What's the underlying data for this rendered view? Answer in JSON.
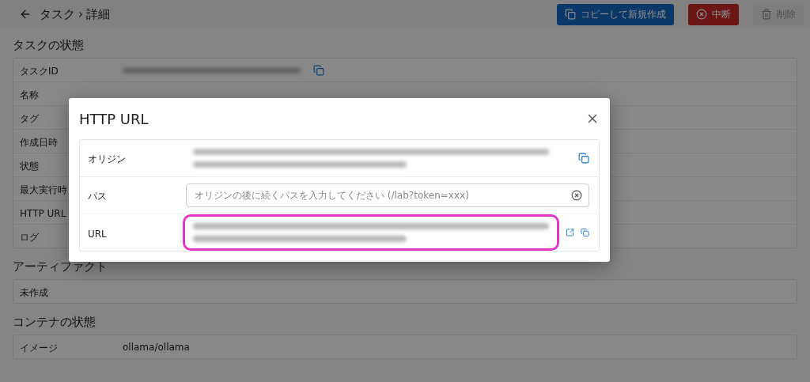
{
  "header": {
    "breadcrumb": [
      "タスク",
      "詳細"
    ],
    "separator": "›",
    "actions": [
      {
        "label": "コピーして新規作成",
        "kind": "primary",
        "disabled": false
      },
      {
        "label": "中断",
        "kind": "danger",
        "disabled": false
      },
      {
        "label": "削除",
        "kind": "delete",
        "disabled": true
      }
    ]
  },
  "sections": [
    {
      "title": "タスクの状態",
      "rows": [
        {
          "label": "タスクID",
          "kind": "blurred",
          "copyable": true
        },
        {
          "label": "名称",
          "kind": "empty"
        },
        {
          "label": "タグ",
          "kind": "empty"
        },
        {
          "label": "作成日時",
          "kind": "empty"
        },
        {
          "label": "状態",
          "kind": "empty"
        },
        {
          "label": "最大実行時",
          "kind": "empty"
        },
        {
          "label": "HTTP URL",
          "kind": "empty"
        },
        {
          "label": "ログ",
          "kind": "empty"
        }
      ]
    },
    {
      "title": "アーティファクト",
      "rows": [
        {
          "label": "未作成",
          "kind": "empty"
        }
      ]
    },
    {
      "title": "コンテナの状態",
      "rows": [
        {
          "label": "イメージ",
          "kind": "text",
          "value": "ollama/ollama"
        }
      ]
    }
  ],
  "dialog": {
    "title": "HTTP URL",
    "rows": [
      {
        "label": "オリジン",
        "kind": "blurred",
        "copyable": true
      },
      {
        "label": "パス",
        "kind": "input",
        "placeholder": "オリジンの後に続くパスを入力してください (/lab?token=xxx)",
        "clearable": true
      },
      {
        "label": "URL",
        "kind": "blurred",
        "highlighted": true,
        "openable": true,
        "copyable": true
      }
    ]
  }
}
